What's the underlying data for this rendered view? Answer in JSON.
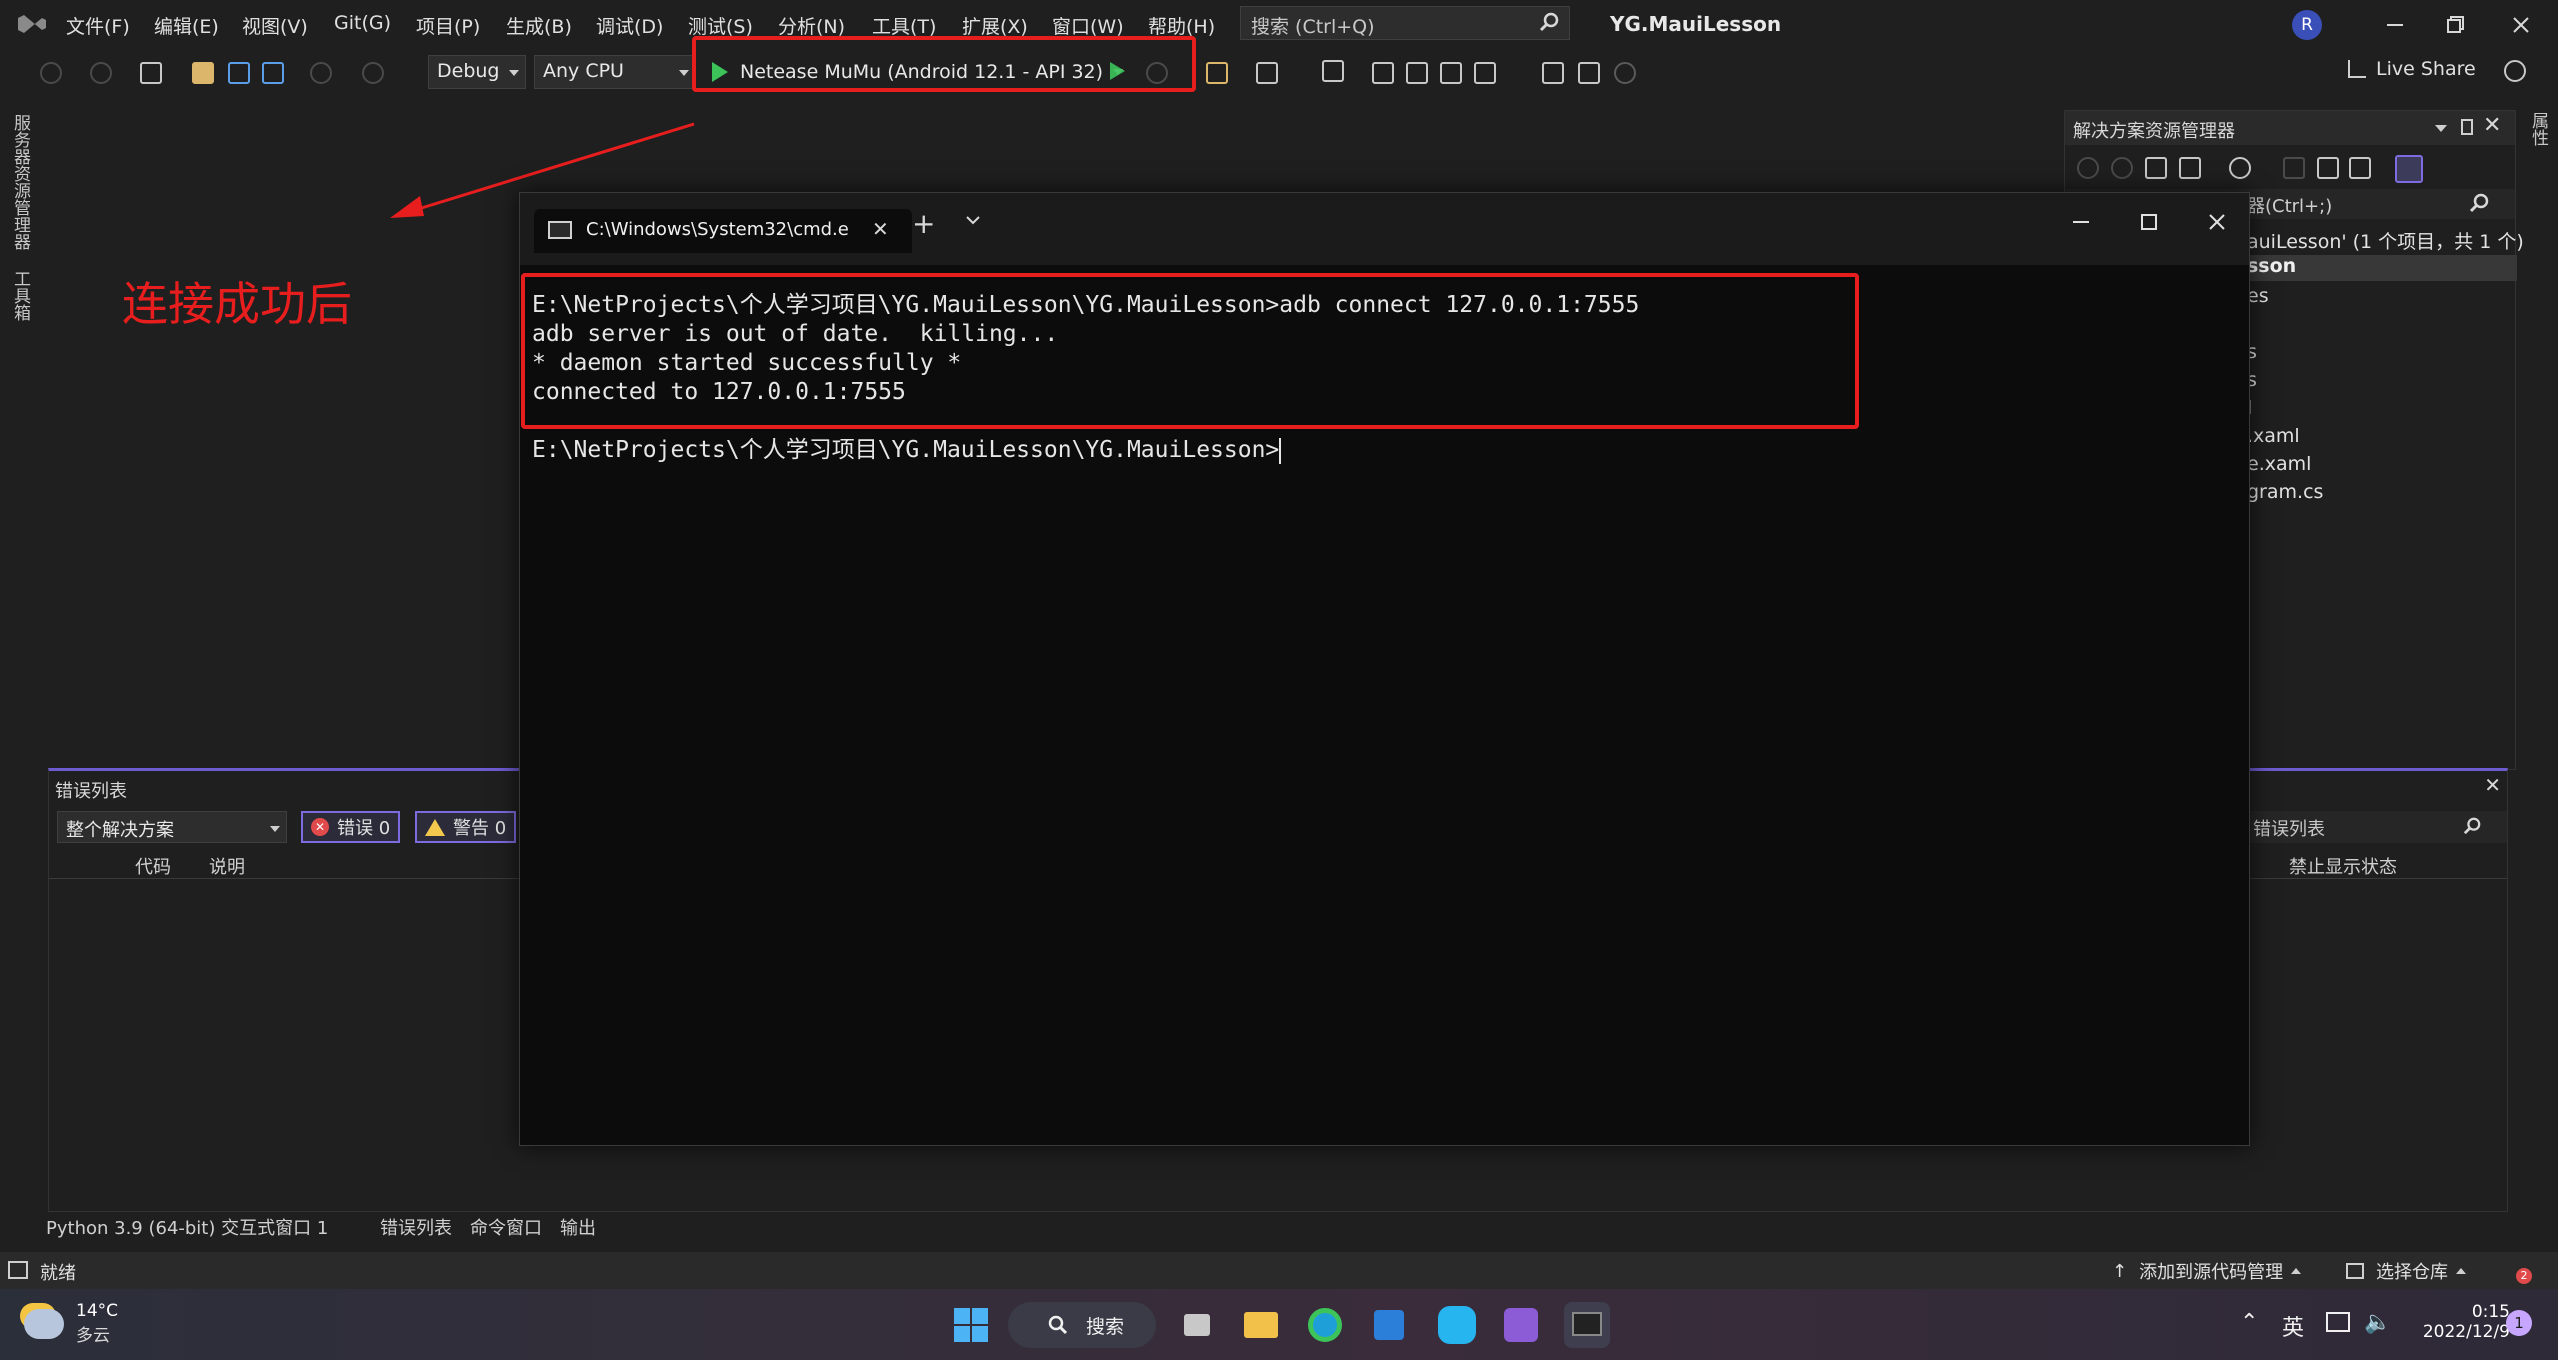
{
  "app": {
    "title": "YG.MauiLesson",
    "menu": [
      "文件(F)",
      "编辑(E)",
      "视图(V)",
      "Git(G)",
      "项目(P)",
      "生成(B)",
      "调试(D)",
      "测试(S)",
      "分析(N)",
      "工具(T)",
      "扩展(X)",
      "窗口(W)",
      "帮助(H)"
    ],
    "search_placeholder": "搜索 (Ctrl+Q)",
    "avatar": "R",
    "window_controls": [
      "minimize",
      "restore",
      "close"
    ]
  },
  "toolbar": {
    "config": "Debug",
    "platform": "Any CPU",
    "run_target": "Netease MuMu (Android 12.1 - API 32)",
    "live_share": "Live Share"
  },
  "left_rail": {
    "server_explorer": "服务器资源管理器",
    "toolbox": "工具箱"
  },
  "right_rail": {
    "properties": "属性"
  },
  "annotation": {
    "text": "连接成功后",
    "color": "#e81e1e"
  },
  "solution_explorer": {
    "title": "解决方案资源管理器",
    "search_partial": "器(Ctrl+;)",
    "lines": [
      "auiLesson' (1 个项目，共 1 个)",
      "sson",
      "es",
      "s",
      "s",
      "l",
      ".xaml",
      "e.xaml",
      "gram.cs"
    ]
  },
  "error_list": {
    "title": "错误列表",
    "scope": "整个解决方案",
    "errors_label": "错误 0",
    "warnings_label": "警告 0",
    "columns": [
      "代码",
      "说明"
    ],
    "right_search_placeholder": "错误列表",
    "right_column": "禁止显示状态"
  },
  "cmd_window": {
    "tab_title": "C:\\Windows\\System32\\cmd.e",
    "lines": [
      "E:\\NetProjects\\个人学习项目\\YG.MauiLesson\\YG.MauiLesson>adb connect 127.0.0.1:7555",
      "adb server is out of date.  killing...",
      "* daemon started successfully *",
      "connected to 127.0.0.1:7555"
    ],
    "prompt": "E:\\NetProjects\\个人学习项目\\YG.MauiLesson\\YG.MauiLesson>"
  },
  "bottom_tabs": [
    "Python 3.9 (64-bit) 交互式窗口 1",
    "错误列表",
    "命令窗口",
    "输出"
  ],
  "status_bar": {
    "ready": "就绪",
    "add_source_control": "添加到源代码管理",
    "select_repo": "选择仓库",
    "notification_count": "2"
  },
  "taskbar": {
    "temperature": "14°C",
    "weather": "多云",
    "search": "搜索",
    "ime": "英",
    "time": "0:15",
    "date": "2022/12/9",
    "notifications": "1"
  }
}
